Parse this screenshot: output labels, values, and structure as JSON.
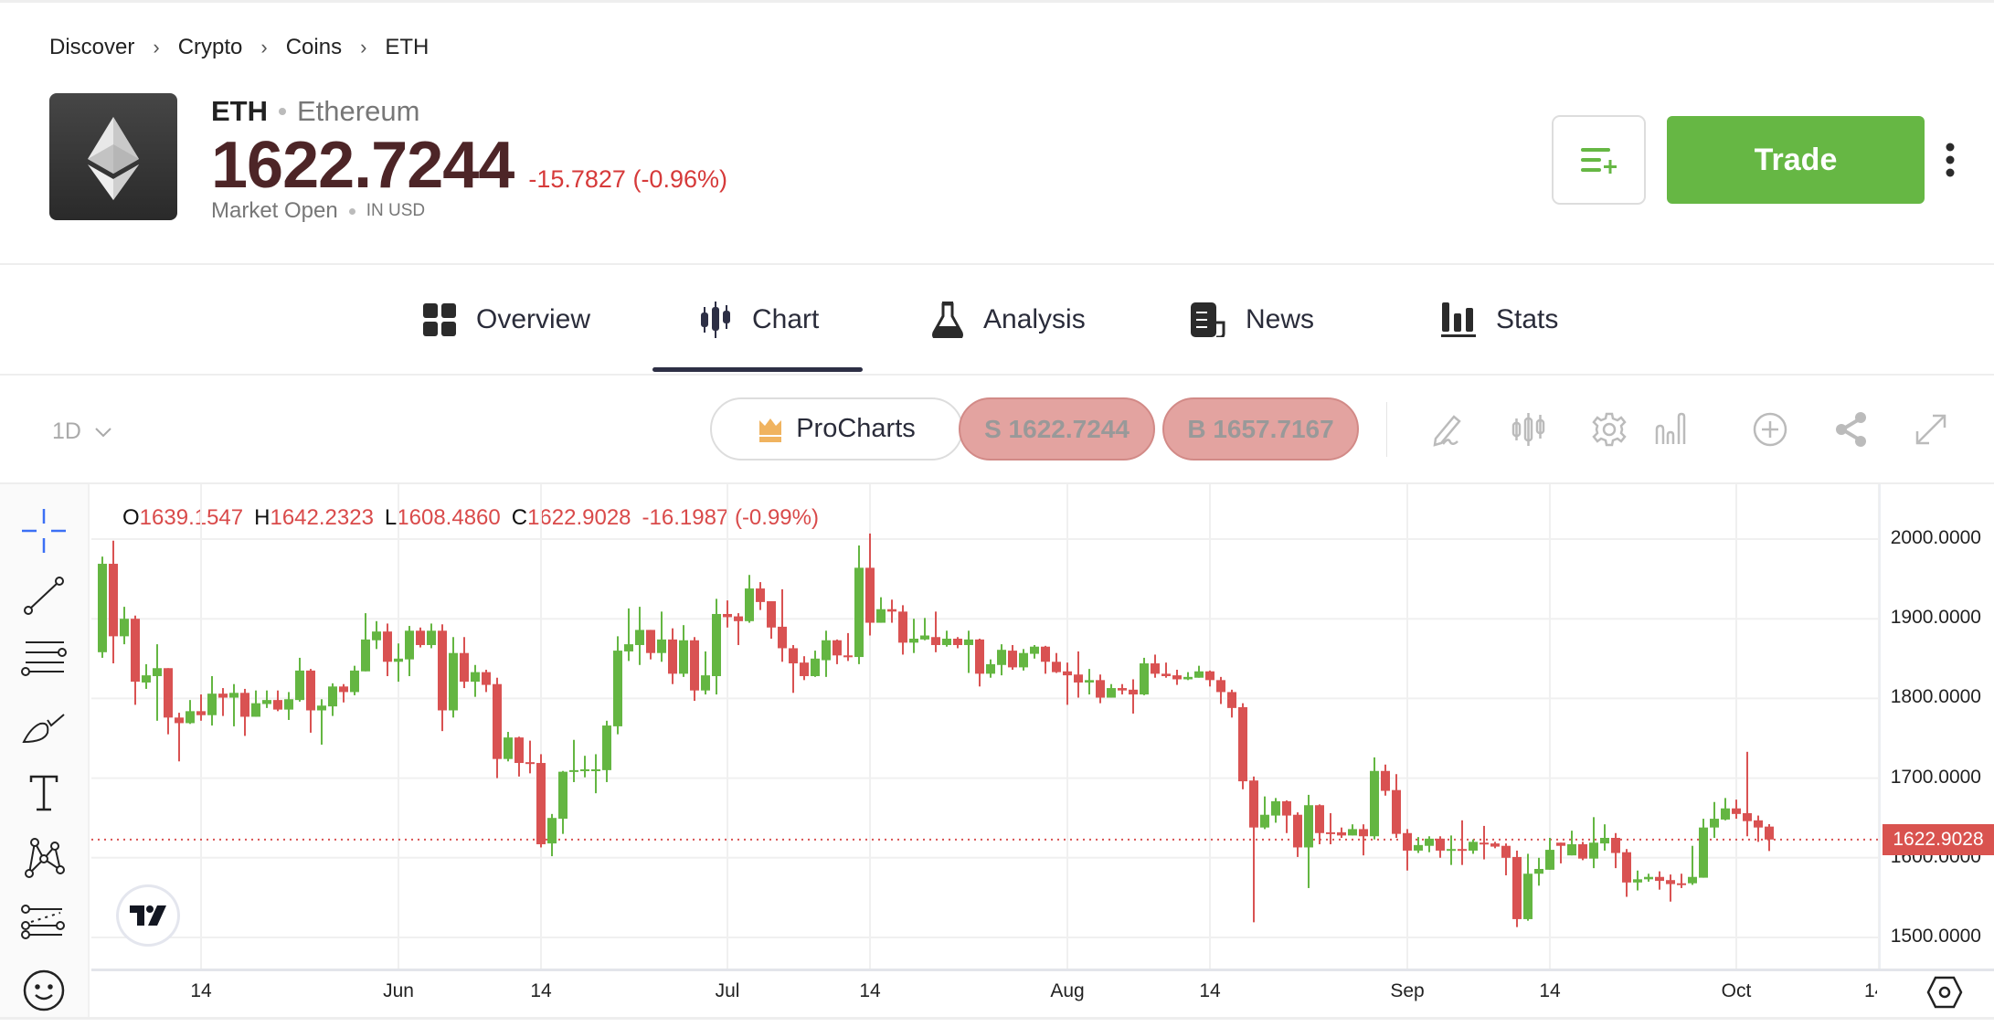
{
  "breadcrumb": [
    "Discover",
    "Crypto",
    "Coins",
    "ETH"
  ],
  "instrument": {
    "symbol": "ETH",
    "name": "Ethereum",
    "price": "1622.7244",
    "change": "-15.7827 (-0.96%)",
    "market_status": "Market Open",
    "currency": "IN USD"
  },
  "actions": {
    "trade_label": "Trade",
    "watchlist_icon": "add-to-list-icon",
    "more_icon": "kebab-icon"
  },
  "tabs": [
    {
      "label": "Overview",
      "icon": "grid-icon",
      "active": false
    },
    {
      "label": "Chart",
      "icon": "candlestick-icon",
      "active": true
    },
    {
      "label": "Analysis",
      "icon": "flask-icon",
      "active": false
    },
    {
      "label": "News",
      "icon": "newspaper-icon",
      "active": false
    },
    {
      "label": "Stats",
      "icon": "bar-chart-icon",
      "active": false
    }
  ],
  "chart_toolbar": {
    "timeframe": "1D",
    "procharts_label": "ProCharts",
    "sell_label": "S 1622.7244",
    "buy_label": "B 1657.7167",
    "tools": [
      "draw-icon",
      "chart-type-icon",
      "settings-icon",
      "indicators-icon",
      "add-icon",
      "share-icon",
      "fullscreen-icon"
    ]
  },
  "drawing_tools": [
    "crosshair-icon",
    "trend-line-icon",
    "fib-retracement-icon",
    "brush-icon",
    "text-icon",
    "pattern-icon",
    "forecast-icon",
    "emoji-icon"
  ],
  "ohlc_legend": {
    "o_key": "O",
    "o": "1639.1547",
    "h_key": "H",
    "h": "1642.2323",
    "l_key": "L",
    "l": "1608.4860",
    "c_key": "C",
    "c": "1622.9028",
    "change": "-16.1987 (-0.99%)"
  },
  "colors": {
    "up": "#64b642",
    "down": "#d95252",
    "accent": "#66b744",
    "price_text": "#4d2527"
  },
  "chart_data": {
    "type": "candlestick",
    "interval": "1D",
    "ylim": [
      1500,
      2000
    ],
    "y_ticks": [
      "2000.0000",
      "1900.0000",
      "1800.0000",
      "1700.0000",
      "1600.0000",
      "1500.0000"
    ],
    "y_tick_values": [
      2000,
      1900,
      1800,
      1700,
      1600,
      1500
    ],
    "current_price": 1622.9028,
    "current_price_label": "1622.9028",
    "grid": true,
    "x_ticks": [
      {
        "label": "14",
        "month": "May",
        "day": 14
      },
      {
        "label": "Jun",
        "month": "Jun",
        "day": 1
      },
      {
        "label": "14",
        "month": "Jun",
        "day": 14
      },
      {
        "label": "Jul",
        "month": "Jul",
        "day": 1
      },
      {
        "label": "14",
        "month": "Jul",
        "day": 14
      },
      {
        "label": "Aug",
        "month": "Aug",
        "day": 1
      },
      {
        "label": "14",
        "month": "Aug",
        "day": 14
      },
      {
        "label": "Sep",
        "month": "Sep",
        "day": 1
      },
      {
        "label": "14",
        "month": "Sep",
        "day": 14
      },
      {
        "label": "Oct",
        "month": "Oct",
        "day": 1
      },
      {
        "label": "14",
        "month": "Oct",
        "day": 14
      }
    ],
    "ohlc_fields": [
      "open",
      "high",
      "low",
      "close"
    ],
    "months": [
      {
        "month": "May",
        "first_day": 5,
        "candles": [
          [
            1858,
            1978,
            1851,
            1969
          ],
          [
            1969,
            1998,
            1844,
            1878
          ],
          [
            1878,
            1915,
            1868,
            1900
          ],
          [
            1900,
            1904,
            1792,
            1821
          ],
          [
            1820,
            1843,
            1812,
            1829
          ],
          [
            1828,
            1868,
            1772,
            1838
          ],
          [
            1838,
            1838,
            1755,
            1776
          ],
          [
            1776,
            1782,
            1721,
            1769
          ],
          [
            1769,
            1798,
            1768,
            1784
          ],
          [
            1784,
            1805,
            1772,
            1779
          ],
          [
            1779,
            1828,
            1766,
            1806
          ],
          [
            1806,
            1813,
            1778,
            1801
          ],
          [
            1801,
            1818,
            1765,
            1807
          ],
          [
            1807,
            1812,
            1753,
            1777
          ],
          [
            1777,
            1810,
            1777,
            1794
          ],
          [
            1793,
            1810,
            1788,
            1798
          ],
          [
            1798,
            1810,
            1784,
            1786
          ],
          [
            1786,
            1808,
            1773,
            1799
          ],
          [
            1798,
            1851,
            1796,
            1835
          ],
          [
            1835,
            1837,
            1757,
            1785
          ],
          [
            1785,
            1799,
            1742,
            1791
          ],
          [
            1790,
            1819,
            1778,
            1815
          ],
          [
            1815,
            1818,
            1795,
            1808
          ],
          [
            1808,
            1841,
            1804,
            1835
          ],
          [
            1834,
            1907,
            1834,
            1874
          ],
          [
            1873,
            1897,
            1862,
            1884
          ],
          [
            1884,
            1894,
            1828,
            1846
          ]
        ]
      },
      {
        "month": "Jun",
        "first_day": 1,
        "candles": [
          [
            1846,
            1869,
            1821,
            1850
          ],
          [
            1849,
            1891,
            1828,
            1885
          ],
          [
            1885,
            1889,
            1864,
            1867
          ],
          [
            1867,
            1894,
            1863,
            1885
          ],
          [
            1885,
            1893,
            1759,
            1785
          ],
          [
            1785,
            1877,
            1776,
            1857
          ],
          [
            1857,
            1877,
            1813,
            1821
          ],
          [
            1821,
            1842,
            1802,
            1833
          ],
          [
            1833,
            1836,
            1808,
            1817
          ],
          [
            1818,
            1826,
            1700,
            1724
          ],
          [
            1724,
            1758,
            1721,
            1751
          ],
          [
            1751,
            1752,
            1702,
            1719
          ],
          [
            1720,
            1747,
            1706,
            1718
          ],
          [
            1719,
            1730,
            1613,
            1617
          ],
          [
            1618,
            1655,
            1602,
            1650
          ],
          [
            1649,
            1709,
            1630,
            1708
          ],
          [
            1708,
            1748,
            1695,
            1710
          ],
          [
            1709,
            1728,
            1701,
            1711
          ],
          [
            1710,
            1730,
            1681,
            1711
          ],
          [
            1710,
            1772,
            1695,
            1766
          ],
          [
            1765,
            1878,
            1755,
            1860
          ],
          [
            1859,
            1913,
            1847,
            1868
          ],
          [
            1867,
            1915,
            1842,
            1886
          ],
          [
            1886,
            1886,
            1849,
            1857
          ],
          [
            1857,
            1909,
            1846,
            1874
          ],
          [
            1874,
            1888,
            1818,
            1831
          ],
          [
            1831,
            1892,
            1827,
            1873
          ],
          [
            1873,
            1877,
            1797,
            1810
          ],
          [
            1810,
            1859,
            1805,
            1829
          ],
          [
            1828,
            1925,
            1805,
            1906
          ]
        ]
      },
      {
        "month": "Jul",
        "first_day": 1,
        "candles": [
          [
            1906,
            1923,
            1889,
            1902
          ],
          [
            1903,
            1907,
            1867,
            1897
          ],
          [
            1897,
            1955,
            1895,
            1938
          ],
          [
            1938,
            1946,
            1911,
            1921
          ],
          [
            1922,
            1922,
            1875,
            1889
          ],
          [
            1890,
            1937,
            1846,
            1863
          ],
          [
            1863,
            1867,
            1807,
            1844
          ],
          [
            1845,
            1853,
            1823,
            1828
          ],
          [
            1828,
            1860,
            1827,
            1850
          ],
          [
            1848,
            1885,
            1827,
            1873
          ],
          [
            1873,
            1874,
            1843,
            1854
          ],
          [
            1854,
            1882,
            1847,
            1852
          ],
          [
            1852,
            1992,
            1843,
            1964
          ],
          [
            1964,
            2007,
            1879,
            1895
          ],
          [
            1895,
            1927,
            1895,
            1912
          ],
          [
            1912,
            1924,
            1895,
            1909
          ],
          [
            1909,
            1917,
            1855,
            1870
          ],
          [
            1870,
            1900,
            1857,
            1875
          ],
          [
            1874,
            1901,
            1873,
            1879
          ],
          [
            1877,
            1909,
            1858,
            1867
          ],
          [
            1867,
            1885,
            1865,
            1875
          ],
          [
            1875,
            1877,
            1863,
            1867
          ],
          [
            1867,
            1885,
            1832,
            1874
          ],
          [
            1874,
            1875,
            1815,
            1831
          ],
          [
            1831,
            1849,
            1826,
            1843
          ],
          [
            1842,
            1868,
            1829,
            1861
          ],
          [
            1860,
            1867,
            1836,
            1839
          ],
          [
            1839,
            1862,
            1835,
            1857
          ],
          [
            1856,
            1867,
            1850,
            1865
          ],
          [
            1865,
            1866,
            1831,
            1846
          ],
          [
            1846,
            1857,
            1832,
            1833
          ]
        ]
      },
      {
        "month": "Aug",
        "first_day": 1,
        "candles": [
          [
            1834,
            1845,
            1792,
            1829
          ],
          [
            1830,
            1859,
            1801,
            1820
          ],
          [
            1820,
            1837,
            1805,
            1823
          ],
          [
            1823,
            1830,
            1794,
            1801
          ],
          [
            1801,
            1818,
            1801,
            1813
          ],
          [
            1813,
            1818,
            1805,
            1810
          ],
          [
            1811,
            1824,
            1781,
            1805
          ],
          [
            1805,
            1851,
            1804,
            1844
          ],
          [
            1844,
            1855,
            1826,
            1831
          ],
          [
            1831,
            1845,
            1826,
            1828
          ],
          [
            1829,
            1836,
            1817,
            1824
          ],
          [
            1824,
            1833,
            1823,
            1827
          ],
          [
            1826,
            1841,
            1826,
            1834
          ],
          [
            1834,
            1835,
            1815,
            1823
          ],
          [
            1823,
            1827,
            1793,
            1808
          ],
          [
            1808,
            1811,
            1776,
            1788
          ],
          [
            1789,
            1794,
            1686,
            1696
          ],
          [
            1697,
            1702,
            1519,
            1638
          ],
          [
            1638,
            1677,
            1636,
            1654
          ],
          [
            1653,
            1675,
            1644,
            1671
          ],
          [
            1671,
            1672,
            1631,
            1653
          ],
          [
            1654,
            1657,
            1601,
            1613
          ],
          [
            1613,
            1679,
            1562,
            1666
          ],
          [
            1666,
            1667,
            1617,
            1631
          ],
          [
            1632,
            1656,
            1617,
            1630
          ],
          [
            1632,
            1638,
            1625,
            1628
          ],
          [
            1628,
            1642,
            1628,
            1636
          ],
          [
            1636,
            1642,
            1603,
            1627
          ],
          [
            1627,
            1726,
            1623,
            1709
          ],
          [
            1709,
            1717,
            1678,
            1684
          ],
          [
            1685,
            1705,
            1625,
            1630
          ]
        ]
      },
      {
        "month": "Sep",
        "first_day": 1,
        "candles": [
          [
            1631,
            1636,
            1584,
            1609
          ],
          [
            1609,
            1626,
            1606,
            1616
          ],
          [
            1615,
            1627,
            1607,
            1624
          ],
          [
            1624,
            1627,
            1600,
            1609
          ],
          [
            1609,
            1628,
            1591,
            1611
          ],
          [
            1611,
            1647,
            1591,
            1609
          ],
          [
            1609,
            1623,
            1605,
            1620
          ],
          [
            1619,
            1640,
            1598,
            1618
          ],
          [
            1618,
            1620,
            1612,
            1614
          ],
          [
            1615,
            1618,
            1578,
            1600
          ],
          [
            1601,
            1609,
            1513,
            1523
          ],
          [
            1523,
            1605,
            1521,
            1580
          ],
          [
            1580,
            1600,
            1565,
            1586
          ],
          [
            1585,
            1625,
            1585,
            1610
          ],
          [
            1619,
            1619,
            1593,
            1615
          ],
          [
            1603,
            1634,
            1603,
            1617
          ],
          [
            1617,
            1620,
            1597,
            1599
          ],
          [
            1599,
            1651,
            1587,
            1619
          ],
          [
            1618,
            1642,
            1609,
            1625
          ],
          [
            1625,
            1631,
            1587,
            1606
          ],
          [
            1607,
            1611,
            1551,
            1569
          ],
          [
            1569,
            1584,
            1559,
            1573
          ],
          [
            1573,
            1580,
            1570,
            1576
          ],
          [
            1576,
            1583,
            1560,
            1571
          ],
          [
            1572,
            1579,
            1545,
            1567
          ],
          [
            1568,
            1580,
            1562,
            1567
          ],
          [
            1568,
            1615,
            1566,
            1576
          ],
          [
            1575,
            1649,
            1575,
            1638
          ],
          [
            1638,
            1670,
            1625,
            1649
          ],
          [
            1648,
            1675,
            1647,
            1662
          ]
        ]
      },
      {
        "month": "Oct",
        "first_day": 1,
        "candles": [
          [
            1662,
            1673,
            1649,
            1655
          ],
          [
            1656,
            1733,
            1627,
            1646
          ],
          [
            1647,
            1653,
            1620,
            1638
          ],
          [
            1639.1547,
            1642.2323,
            1608.486,
            1622.9028
          ]
        ]
      }
    ]
  }
}
